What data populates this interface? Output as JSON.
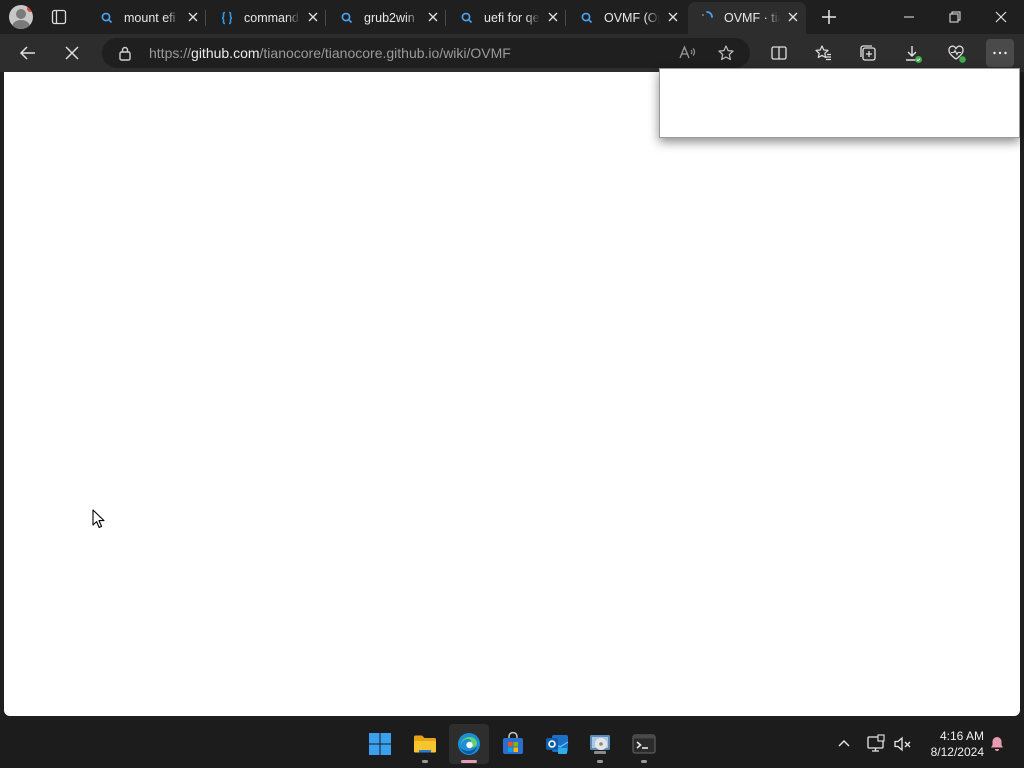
{
  "browser": {
    "tabs": [
      {
        "title": "mount efi",
        "icon": "search-icon",
        "active": false
      },
      {
        "title": "command",
        "icon": "braces-icon",
        "active": false
      },
      {
        "title": "grub2win",
        "icon": "search-icon",
        "active": false
      },
      {
        "title": "uefi for qe",
        "icon": "search-icon",
        "active": false
      },
      {
        "title": "OVMF (Op",
        "icon": "search-icon",
        "active": false
      },
      {
        "title": "OVMF · tia",
        "icon": "loading-spinner-icon",
        "active": true
      }
    ],
    "address_bar": {
      "protocol": "https://",
      "domain": "github.com",
      "path": "/tianocore/tianocore.github.io/wiki/OVMF"
    },
    "state": "loading"
  },
  "taskbar": {
    "apps": [
      {
        "name": "start-button",
        "icon": "windows-logo-icon"
      },
      {
        "name": "file-explorer",
        "icon": "folder-icon"
      },
      {
        "name": "edge",
        "icon": "edge-icon",
        "active": true
      },
      {
        "name": "microsoft-store",
        "icon": "store-icon"
      },
      {
        "name": "outlook-new",
        "icon": "outlook-icon"
      },
      {
        "name": "disk-utility",
        "icon": "disk-icon"
      },
      {
        "name": "terminal",
        "icon": "terminal-icon"
      }
    ],
    "clock": {
      "time": "4:16 AM",
      "date": "8/12/2024"
    }
  },
  "colors": {
    "accent_blue": "#4aa3f0",
    "chrome_dark": "#1f1f1f",
    "toolbar": "#2d2d2d",
    "active_indicator": "#e89bb2"
  }
}
